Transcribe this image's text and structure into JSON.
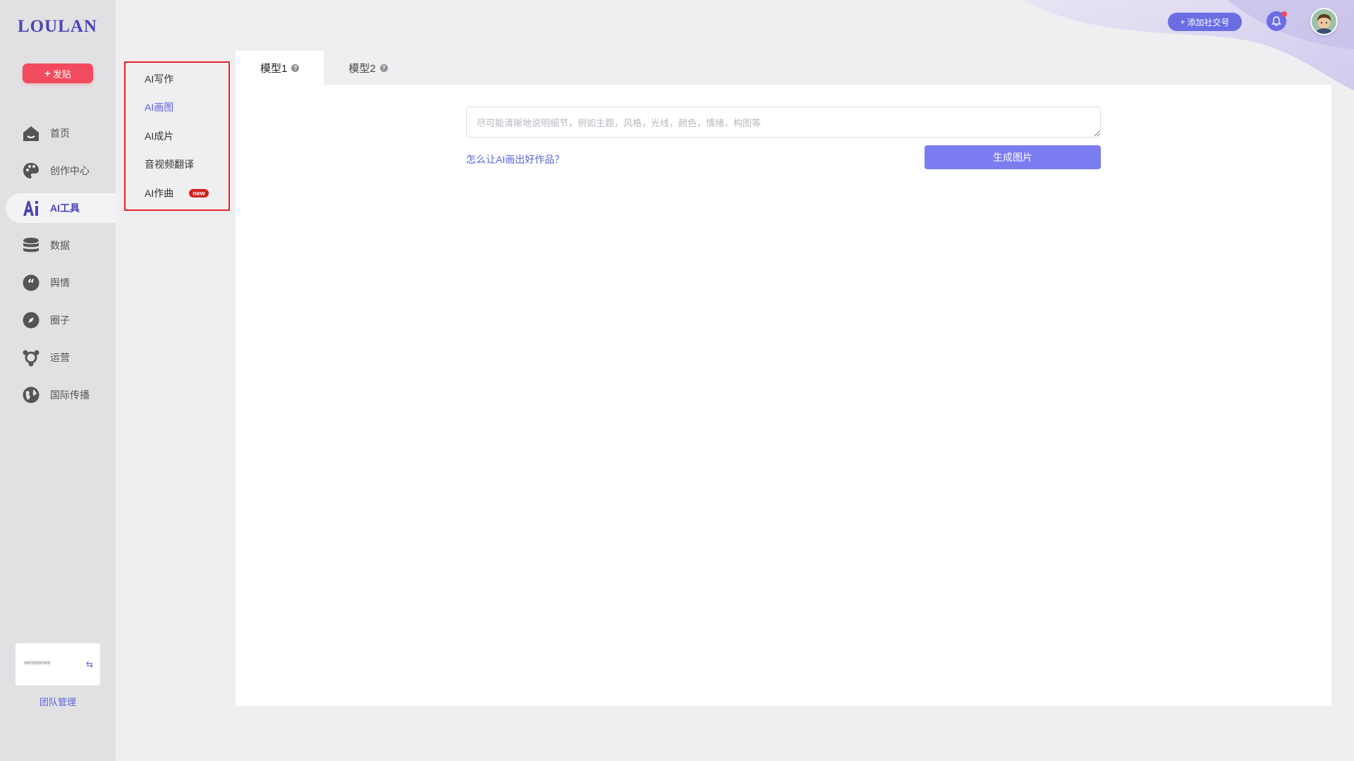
{
  "brand": {
    "logo": "LOULAN"
  },
  "sidebar": {
    "post_button": "发贴",
    "items": [
      {
        "label": "首页",
        "icon": "home-icon"
      },
      {
        "label": "创作中心",
        "icon": "palette-icon"
      },
      {
        "label": "AI工具",
        "icon": "ai-icon",
        "active": true
      },
      {
        "label": "数据",
        "icon": "database-icon"
      },
      {
        "label": "舆情",
        "icon": "quote-icon"
      },
      {
        "label": "圈子",
        "icon": "compass-icon"
      },
      {
        "label": "运营",
        "icon": "operation-icon"
      },
      {
        "label": "国际传播",
        "icon": "globe-icon"
      }
    ],
    "team": {
      "name": "**'***'**",
      "switch_icon": "switch-icon"
    },
    "team_manage": "团队管理"
  },
  "submenu": {
    "items": [
      {
        "label": "AI写作"
      },
      {
        "label": "AI画图",
        "active": true
      },
      {
        "label": "AI成片"
      },
      {
        "label": "音视频翻译"
      },
      {
        "label": "AI作曲",
        "badge": "new"
      }
    ]
  },
  "header": {
    "add_social": "添加社交号",
    "notification_icon": "bell-icon",
    "avatar_icon": "avatar-icon"
  },
  "main": {
    "tabs": [
      {
        "label": "模型1",
        "active": true
      },
      {
        "label": "模型2"
      }
    ],
    "prompt_placeholder": "尽可能清晰地说明细节，例如主题，风格，光线，颜色，情绪，构图等",
    "help_link": "怎么让AI画出好作品？",
    "generate_button": "生成图片"
  },
  "colors": {
    "accent": "#6b6de3",
    "post_button": "#f14b5d",
    "highlight_border": "#e6242a",
    "active_nav": "#4d44b5"
  }
}
